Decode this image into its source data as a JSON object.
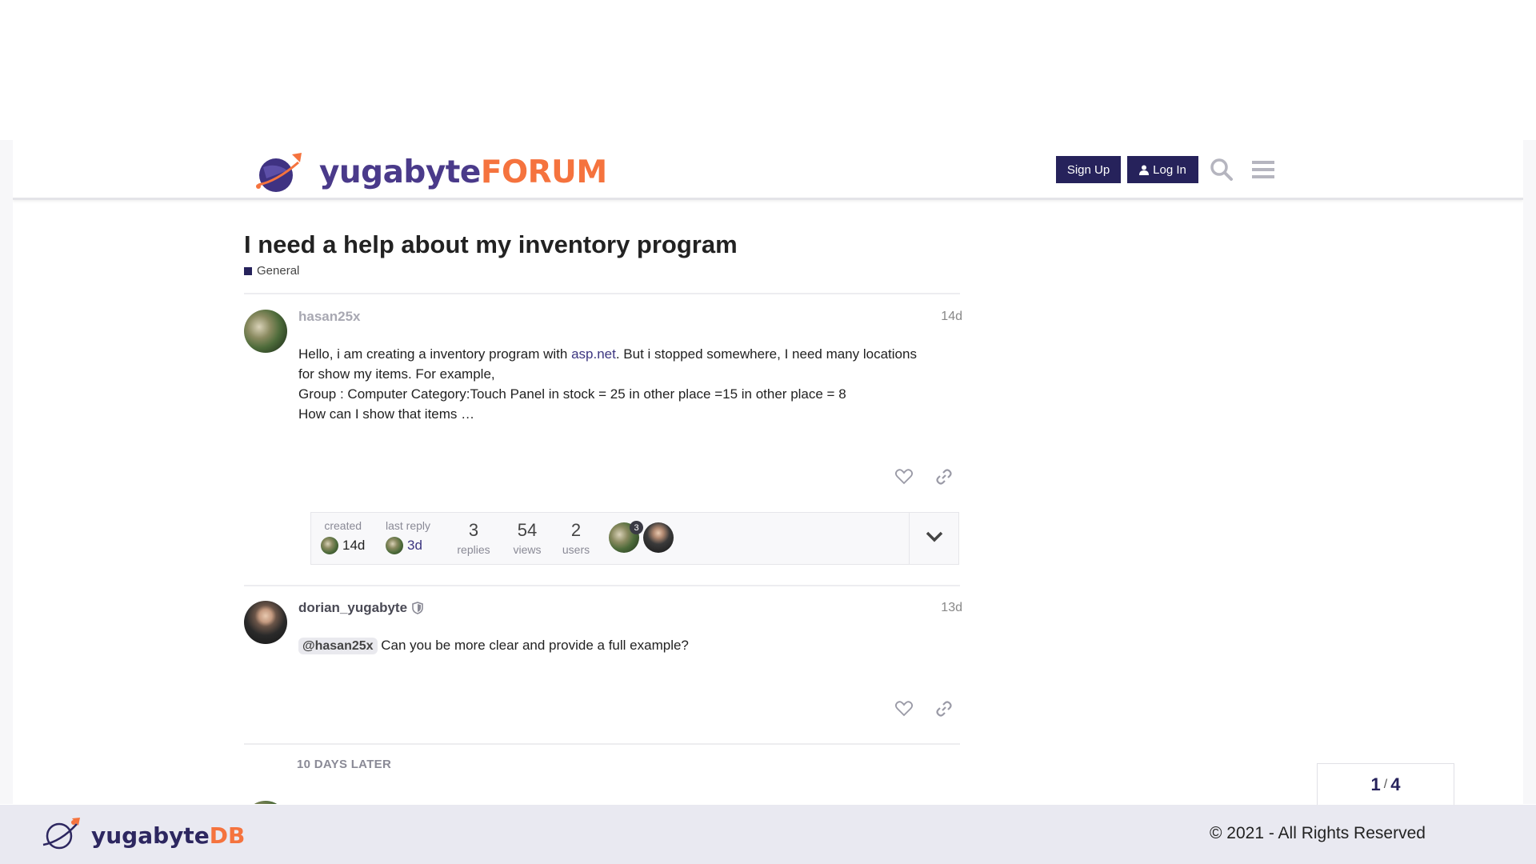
{
  "forum": {
    "logo_part1": "yugabyte",
    "logo_part2": "FORUM",
    "signup_label": "Sign Up",
    "login_label": "Log In"
  },
  "topic": {
    "title": "I need a help about my inventory program",
    "category": "General"
  },
  "posts": [
    {
      "username": "hasan25x",
      "date": "14d",
      "body_line1_a": "Hello, i am creating a inventory program with ",
      "body_link": "asp.net",
      "body_line1_b": ". But i stopped somewhere, I need many locations",
      "body_line2": "for show my items. For example,",
      "body_line3": "Group : Computer Category:Touch Panel in stock = 25 in other place =15 in other place = 8",
      "body_line4": "How can I show that items …"
    },
    {
      "username": "dorian_yugabyte",
      "date": "13d",
      "mention": "@hasan25x",
      "body": " Can you be more clear and provide a full example?"
    }
  ],
  "topic_map": {
    "created_label": "created",
    "created_value": "14d",
    "last_reply_label": "last reply",
    "last_reply_value": "3d",
    "replies_count": "3",
    "replies_label": "replies",
    "views_count": "54",
    "views_label": "views",
    "users_count": "2",
    "users_label": "users",
    "poster_badge": "3"
  },
  "time_gap": "10 DAYS LATER",
  "progress": {
    "current": "1",
    "separator": "/",
    "total": "4"
  },
  "footer": {
    "logo_part1": "yugabyte",
    "logo_part2": "DB",
    "copyright": "© 2021 - All Rights Reserved"
  },
  "colors": {
    "brand_navy": "#26225b",
    "brand_orange": "#f5733e",
    "footer_bg": "#e9e9f1"
  },
  "icons": [
    "rocket-planet-logo-icon",
    "user-icon",
    "search-icon",
    "hamburger-menu-icon",
    "heart-icon",
    "link-icon",
    "shield-icon",
    "chevron-down-icon"
  ]
}
